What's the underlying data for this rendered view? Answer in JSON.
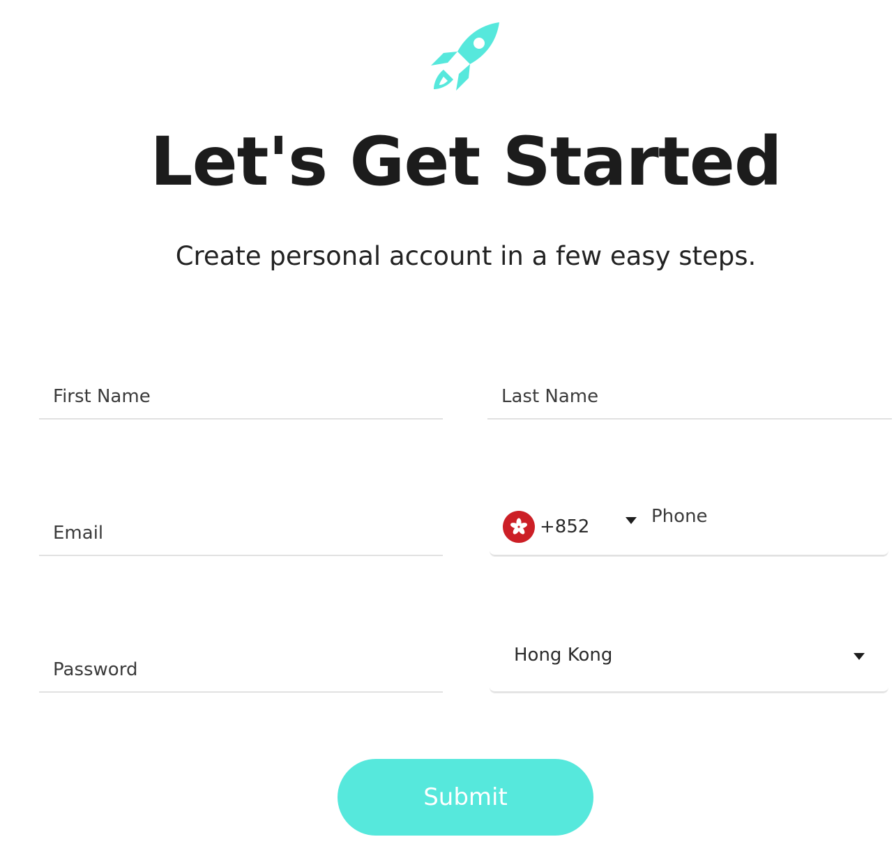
{
  "header": {
    "logo_icon": "rocket-icon",
    "accent_color": "#56e8dc",
    "title": "Let's Get Started",
    "subtitle": "Create personal account in a few easy steps."
  },
  "form": {
    "first_name": {
      "placeholder": "First Name",
      "value": ""
    },
    "last_name": {
      "placeholder": "Last Name",
      "value": ""
    },
    "email": {
      "placeholder": "Email",
      "value": ""
    },
    "phone": {
      "country_flag": "hong-kong-flag-icon",
      "dial_code": "+852",
      "placeholder": "Phone",
      "value": ""
    },
    "password": {
      "placeholder": "Password",
      "value": ""
    },
    "country": {
      "selected": "Hong Kong"
    },
    "submit_label": "Submit"
  }
}
